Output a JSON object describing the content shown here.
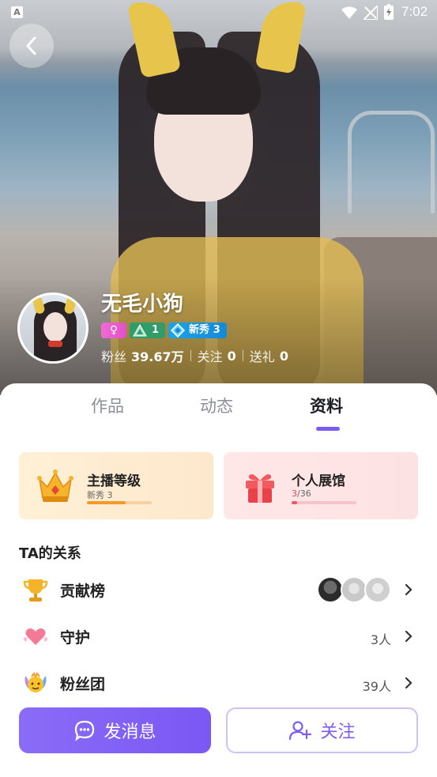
{
  "status_bar": {
    "time": "7:02"
  },
  "profile": {
    "nickname": "无毛小狗",
    "gender_symbol": "♀",
    "level": "1",
    "new_badge": "新秀 3",
    "stats": [
      {
        "label": "粉丝",
        "value": "39.67万"
      },
      {
        "label": "关注",
        "value": "0"
      },
      {
        "label": "送礼",
        "value": "0"
      }
    ]
  },
  "tabs": [
    {
      "label": "作品"
    },
    {
      "label": "动态"
    },
    {
      "label": "资料",
      "active": true
    }
  ],
  "cards": {
    "level": {
      "title": "主播等级",
      "sub": "新秀 3",
      "progress": 0.6
    },
    "gallery": {
      "title": "个人展馆",
      "current": "3",
      "total": "/36",
      "progress": 0.083
    }
  },
  "relations": {
    "title": "TA的关系",
    "items": [
      {
        "label": "贡献榜",
        "count": ""
      },
      {
        "label": "守护",
        "count": "3人"
      },
      {
        "label": "粉丝团",
        "count": "39人"
      }
    ]
  },
  "actions": {
    "message": "发消息",
    "follow": "关注"
  },
  "colors": {
    "accent": "#7b57f4",
    "level_progress": "#f39a2b",
    "gallery_progress": "#ee5764"
  }
}
